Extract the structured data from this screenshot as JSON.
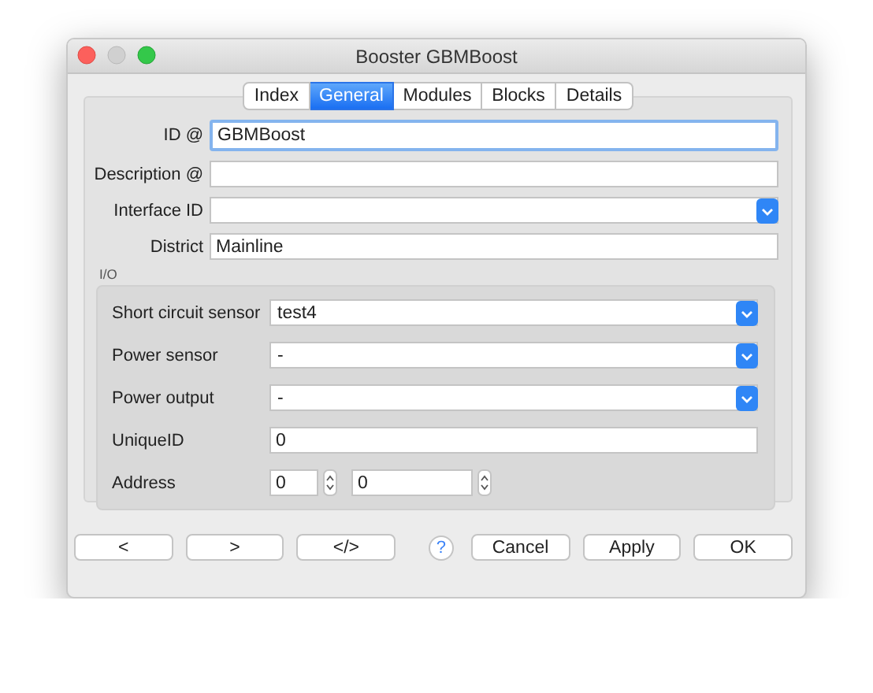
{
  "window": {
    "title": "Booster GBMBoost"
  },
  "tabs": [
    {
      "label": "Index",
      "selected": false
    },
    {
      "label": "General",
      "selected": true
    },
    {
      "label": "Modules",
      "selected": false
    },
    {
      "label": "Blocks",
      "selected": false
    },
    {
      "label": "Details",
      "selected": false
    }
  ],
  "fields": [
    {
      "kind": "text",
      "label": "ID @",
      "value": "GBMBoost",
      "focused": true
    },
    {
      "kind": "text",
      "label": "Description @",
      "focused": false
    },
    {
      "kind": "combo",
      "label": "Interface ID",
      "focused": false
    },
    {
      "kind": "text",
      "label": "District",
      "value": "Mainline",
      "focused": false
    }
  ],
  "io": {
    "title": "I/O",
    "fields": [
      {
        "kind": "combo",
        "label": "Short circuit sensor",
        "value": "test4"
      },
      {
        "kind": "combo",
        "label": "Power sensor",
        "value": "-"
      },
      {
        "kind": "combo",
        "label": "Power output",
        "value": "-"
      },
      {
        "kind": "text",
        "label": "UniqueID",
        "value": "0"
      },
      {
        "kind": "spinners",
        "label": "Address",
        "values": [
          "0",
          "0"
        ]
      }
    ]
  },
  "buttons": [
    {
      "kind": "button",
      "label": "<"
    },
    {
      "kind": "button",
      "label": ">"
    },
    {
      "kind": "button",
      "label": "</>"
    },
    {
      "kind": "help",
      "label": "?"
    },
    {
      "kind": "button",
      "label": "Cancel"
    },
    {
      "kind": "button",
      "label": "Apply"
    },
    {
      "kind": "button",
      "label": "OK"
    }
  ]
}
